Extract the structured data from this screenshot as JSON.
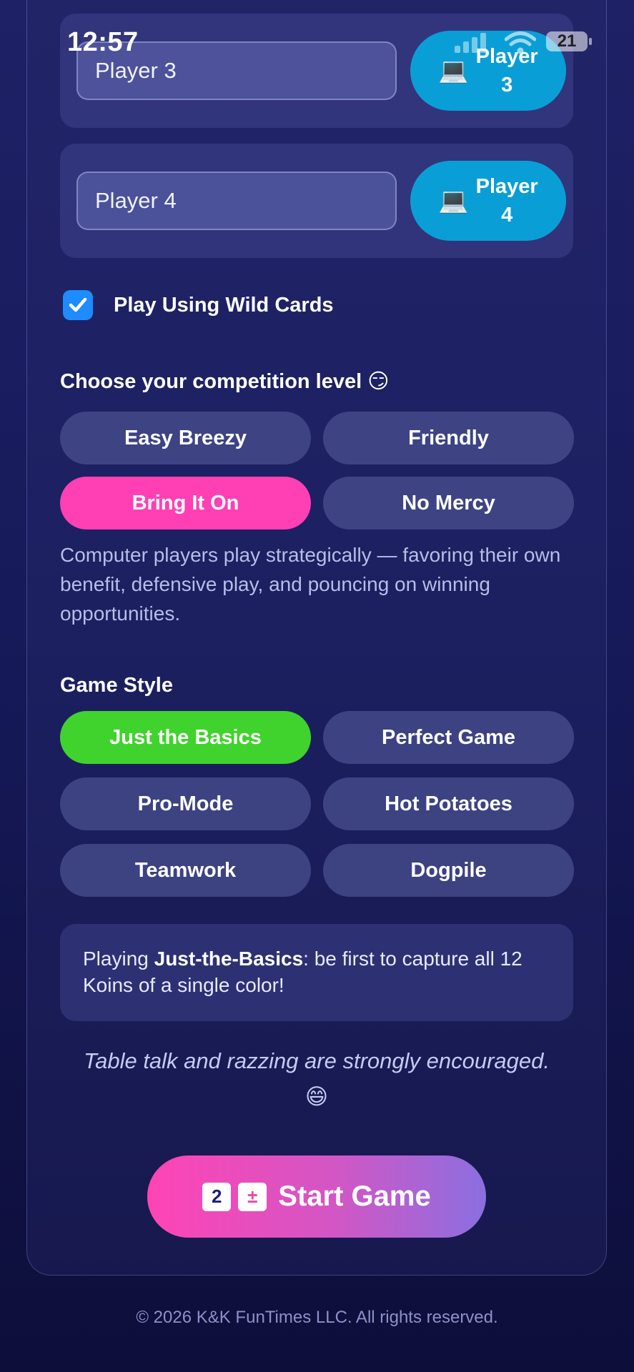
{
  "status_bar": {
    "time": "12:57",
    "battery": "21"
  },
  "players": [
    {
      "name": "Player 3",
      "button_line1": "Player",
      "button_line2": "3",
      "icon": "laptop-icon"
    },
    {
      "name": "Player 4",
      "button_line1": "Player",
      "button_line2": "4",
      "icon": "laptop-icon"
    }
  ],
  "wild_cards": {
    "label": "Play Using Wild Cards",
    "checked": true
  },
  "competition": {
    "title": "Choose your competition level 😏",
    "options": [
      "Easy Breezy",
      "Friendly",
      "Bring It On",
      "No Mercy"
    ],
    "selected": "Bring It On",
    "description": "Computer players play strategically — favoring their own benefit, defensive play, and pouncing on winning opportunities."
  },
  "game_style": {
    "title": "Game Style",
    "options": [
      "Just the Basics",
      "Perfect Game",
      "Pro-Mode",
      "Hot Potatoes",
      "Teamwork",
      "Dogpile"
    ],
    "selected": "Just the Basics"
  },
  "info": {
    "prefix": "Playing ",
    "mode": "Just-the-Basics",
    "suffix": ": be first to capture all 12 Koins of a single color!"
  },
  "table_talk": {
    "text": "Table talk and razzing are strongly encouraged.",
    "emoji": "😄"
  },
  "start_button": {
    "label": "Start Game",
    "icon_1": "2",
    "icon_2": "±"
  },
  "footer": "© 2026 K&K FunTimes LLC. All rights reserved.",
  "colors": {
    "selected_level": "#ff3fb4",
    "selected_style": "#40d32d",
    "computer_button": "#0a9ed6",
    "checkbox": "#1e8bff"
  }
}
